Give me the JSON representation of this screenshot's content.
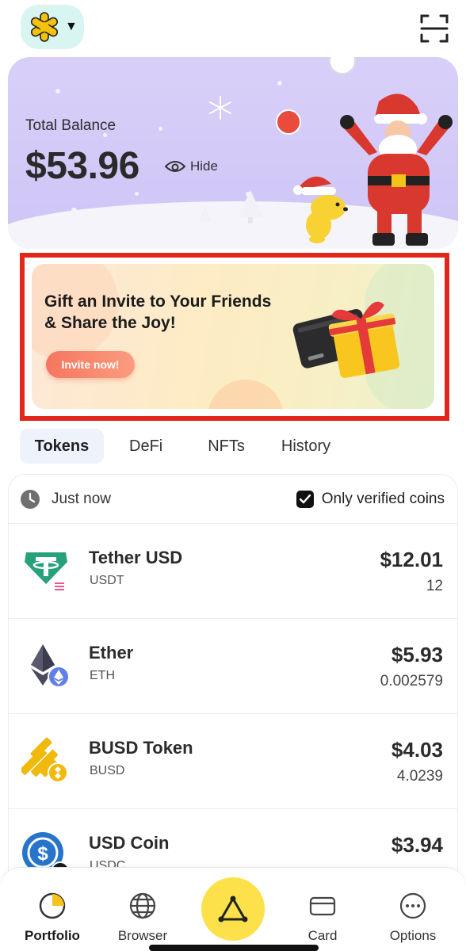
{
  "header": {
    "wallet_icon": "asterisk-wallet-icon",
    "caret_icon": "caret-down-icon",
    "scan_icon": "scan-icon"
  },
  "balance": {
    "label": "Total Balance",
    "value": "$53.96",
    "hide_label": "Hide"
  },
  "banner": {
    "title": "Gift an Invite to Your Friends & Share the Joy!",
    "button_label": "Invite now!"
  },
  "tabs": [
    {
      "label": "Tokens",
      "active": true
    },
    {
      "label": "DeFi",
      "active": false
    },
    {
      "label": "NFTs",
      "active": false
    },
    {
      "label": "History",
      "active": false
    }
  ],
  "list_header": {
    "updated_label": "Just now",
    "verified_label": "Only verified coins",
    "verified_checked": true
  },
  "tokens": [
    {
      "name": "Tether USD",
      "symbol": "USDT",
      "value": "$12.01",
      "amount": "12",
      "icon": "tether-icon",
      "color": "#26a17b"
    },
    {
      "name": "Ether",
      "symbol": "ETH",
      "value": "$5.93",
      "amount": "0.002579",
      "icon": "ether-icon",
      "color": "#627eea"
    },
    {
      "name": "BUSD Token",
      "symbol": "BUSD",
      "value": "$4.03",
      "amount": "4.0239",
      "icon": "busd-icon",
      "color": "#f0b90b"
    },
    {
      "name": "USD Coin",
      "symbol": "USDC",
      "value": "$3.94",
      "amount": "",
      "icon": "usd-coin-icon",
      "color": "#2775ca"
    }
  ],
  "nav": [
    {
      "label": "Portfolio",
      "icon": "portfolio-icon",
      "active": true
    },
    {
      "label": "Browser",
      "icon": "globe-icon",
      "active": false
    },
    {
      "label": "",
      "icon": "triangle-icon",
      "active": false
    },
    {
      "label": "Card",
      "icon": "card-icon",
      "active": false
    },
    {
      "label": "Options",
      "icon": "options-icon",
      "active": false
    }
  ],
  "colors": {
    "accent": "#fce14b",
    "balance_card": "#d8cff9",
    "banner_frame": "#e2261b",
    "invite_button": "#f6765f"
  }
}
